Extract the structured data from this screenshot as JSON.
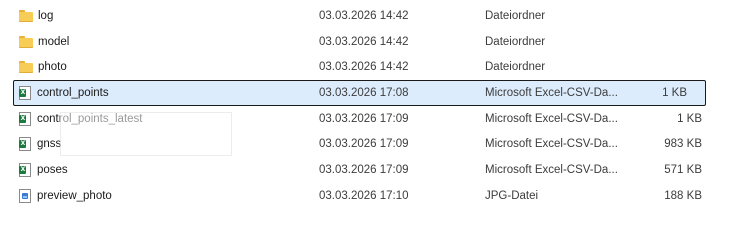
{
  "files": [
    {
      "name": "log",
      "date": "03.03.2026 14:42",
      "type": "Dateiordner",
      "size": "",
      "icon": "folder-icon"
    },
    {
      "name": "model",
      "date": "03.03.2026 14:42",
      "type": "Dateiordner",
      "size": "",
      "icon": "folder-icon"
    },
    {
      "name": "photo",
      "date": "03.03.2026 14:42",
      "type": "Dateiordner",
      "size": "",
      "icon": "folder-icon"
    },
    {
      "name": "control_points",
      "date": "03.03.2026 17:08",
      "type": "Microsoft Excel-CSV-Da...",
      "size": "1 KB",
      "icon": "excel-csv-icon",
      "selected": true
    },
    {
      "name": "control_points_latest",
      "date": "03.03.2026 17:09",
      "type": "Microsoft Excel-CSV-Da...",
      "size": "1 KB",
      "icon": "excel-csv-icon"
    },
    {
      "name": "gnss",
      "date": "03.03.2026 17:09",
      "type": "Microsoft Excel-CSV-Da...",
      "size": "983 KB",
      "icon": "excel-csv-icon"
    },
    {
      "name": "poses",
      "date": "03.03.2026 17:09",
      "type": "Microsoft Excel-CSV-Da...",
      "size": "571 KB",
      "icon": "excel-csv-icon"
    },
    {
      "name": "preview_photo",
      "date": "03.03.2026 17:10",
      "type": "JPG-Datei",
      "size": "188 KB",
      "icon": "jpg-image-icon"
    }
  ],
  "colors": {
    "selection_background": "#dcecfc",
    "folder": "#f8cd57",
    "excel_green": "#1d7a3e"
  }
}
